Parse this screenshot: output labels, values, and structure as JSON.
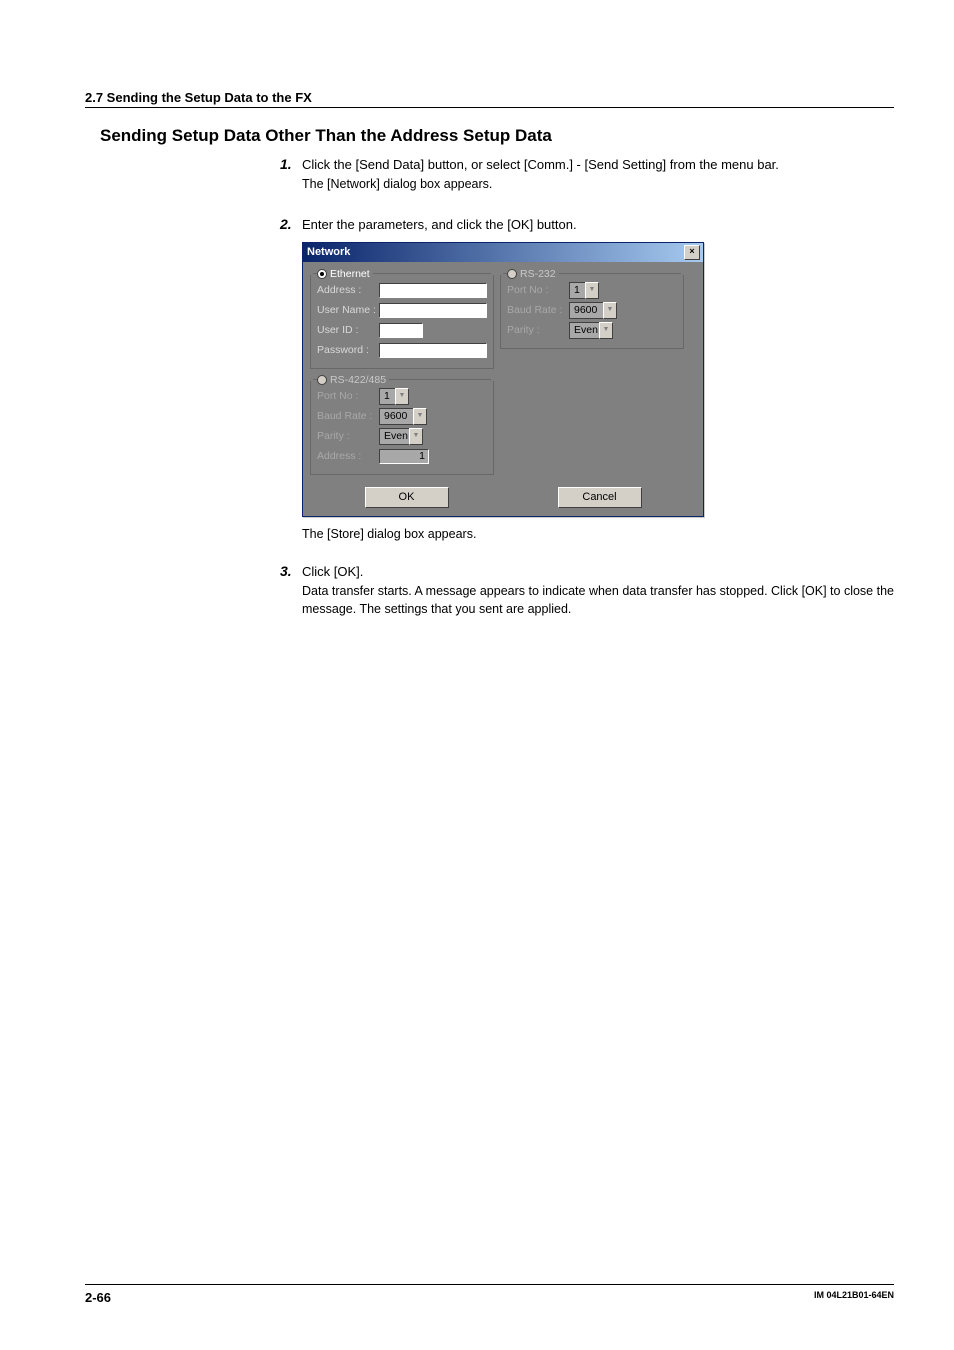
{
  "header": {
    "section": "2.7  Sending the Setup Data to the FX"
  },
  "heading": "Sending Setup Data Other Than the Address Setup Data",
  "steps": [
    {
      "num": "1.",
      "text": "Click the [Send Data] button, or select [Comm.] - [Send Setting] from the menu bar.",
      "sub": "The [Network] dialog box appears."
    },
    {
      "num": "2.",
      "text": "Enter the parameters, and click the [OK] button.",
      "after_dialog": "The [Store] dialog box appears."
    },
    {
      "num": "3.",
      "text": "Click [OK].",
      "sub": "Data transfer starts. A message appears to indicate when data transfer has stopped. Click [OK] to close the message. The settings that you sent are applied."
    }
  ],
  "dialog": {
    "title": "Network",
    "close": "×",
    "ethernet": {
      "radio_label": "Ethernet",
      "fields": {
        "address": "Address :",
        "user_name": "User Name :",
        "user_id": "User ID :",
        "password": "Password :"
      }
    },
    "rs232": {
      "radio_label": "RS-232",
      "fields": {
        "port_no": "Port No :",
        "baud_rate": "Baud Rate :",
        "parity": "Parity :"
      },
      "values": {
        "port_no": "1",
        "baud_rate": "9600",
        "parity": "Even"
      }
    },
    "rs422": {
      "radio_label": "RS-422/485",
      "fields": {
        "port_no": "Port No :",
        "baud_rate": "Baud Rate :",
        "parity": "Parity :",
        "address": "Address :"
      },
      "values": {
        "port_no": "1",
        "baud_rate": "9600",
        "parity": "Even",
        "address": "1"
      }
    },
    "buttons": {
      "ok": "OK",
      "cancel": "Cancel"
    }
  },
  "footer": {
    "page": "2-66",
    "docid": "IM 04L21B01-64EN"
  }
}
